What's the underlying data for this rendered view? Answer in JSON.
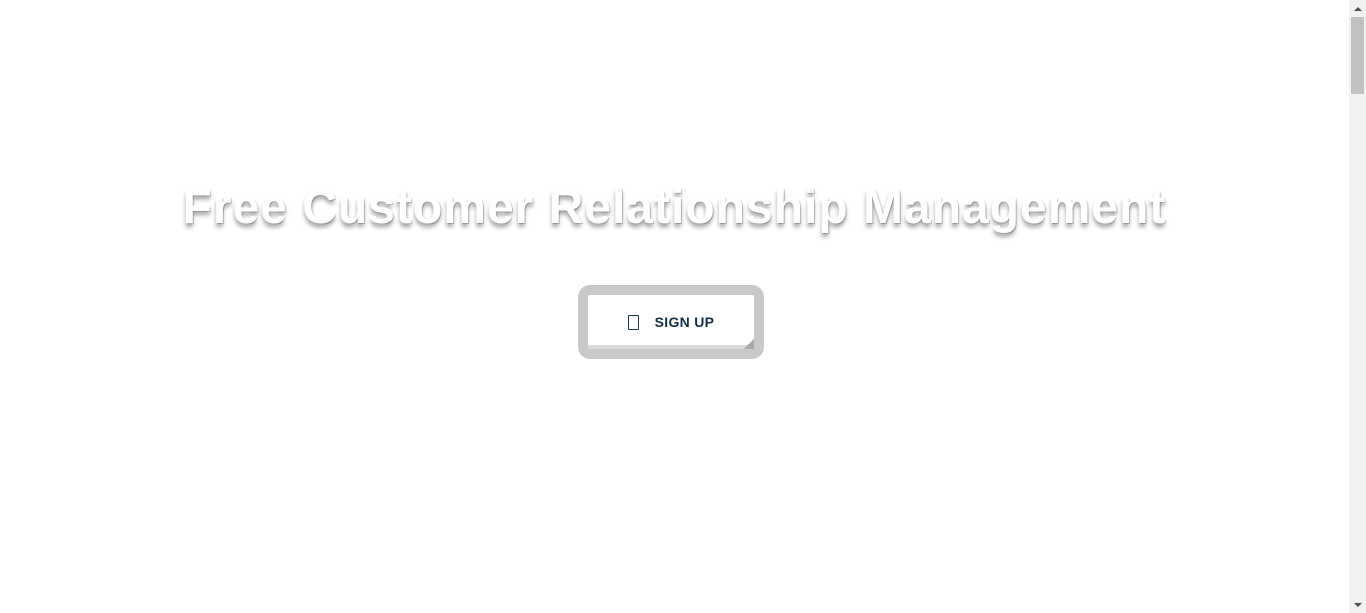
{
  "hero": {
    "title": "Free Customer Relationship Management"
  },
  "signup": {
    "label": "SIGN UP",
    "icon": "phone-icon"
  },
  "colors": {
    "button_text": "#123047",
    "button_frame": "#c9c9c9",
    "background": "#ffffff"
  }
}
